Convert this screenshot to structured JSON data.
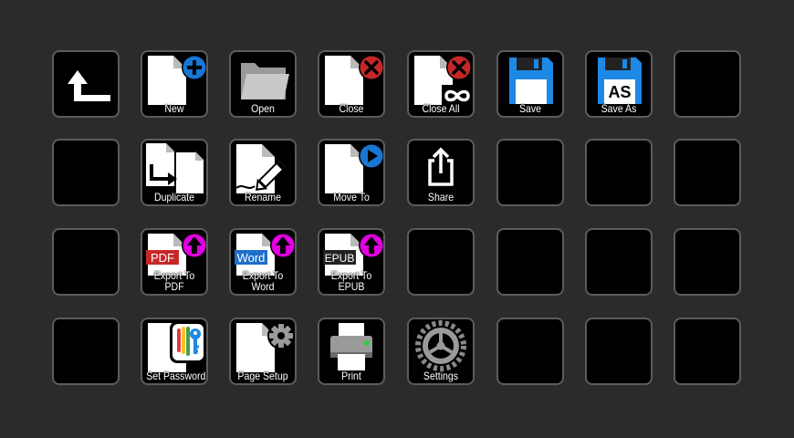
{
  "keys": {
    "new": {
      "label": "New"
    },
    "open": {
      "label": "Open"
    },
    "close": {
      "label": "Close"
    },
    "close_all": {
      "label": "Close All"
    },
    "save": {
      "label": "Save"
    },
    "save_as": {
      "label": "Save As",
      "badge": "AS"
    },
    "duplicate": {
      "label": "Duplicate"
    },
    "rename": {
      "label": "Rename"
    },
    "move_to": {
      "label": "Move To"
    },
    "share": {
      "label": "Share"
    },
    "export_pdf": {
      "label_line1": "Export To",
      "label_line2": "PDF",
      "badge": "PDF"
    },
    "export_word": {
      "label_line1": "Export To",
      "label_line2": "Word",
      "badge": "Word"
    },
    "export_epub": {
      "label_line1": "Export To",
      "label_line2": "EPUB",
      "badge": "EPUB"
    },
    "set_password": {
      "label": "Set Password"
    },
    "page_setup": {
      "label": "Page Setup"
    },
    "print": {
      "label": "Print"
    },
    "settings": {
      "label": "Settings"
    }
  },
  "icons": {
    "back": "back-arrow-icon",
    "new": "document-plus-icon",
    "open": "folder-icon",
    "close": "document-x-icon",
    "close_all": "document-x-infinity-icon",
    "save": "floppy-disk-icon",
    "save_as": "floppy-disk-as-icon",
    "duplicate": "duplicate-documents-icon",
    "rename": "document-pencil-icon",
    "move_to": "document-play-icon",
    "share": "share-icon",
    "export_pdf": "document-pdf-upload-icon",
    "export_word": "document-word-upload-icon",
    "export_epub": "document-epub-upload-icon",
    "set_password": "document-key-icon",
    "page_setup": "document-gear-icon",
    "print": "printer-icon",
    "settings": "gear-icon"
  },
  "colors": {
    "background": "#2b2b2b",
    "key_fill": "#000000",
    "key_border": "#5c5c5c",
    "add_blue": "#1976d2",
    "close_red": "#c62828",
    "floppy_blue": "#1e88e5",
    "upload_magenta": "#e000e0",
    "pdf_red": "#c62828",
    "word_blue": "#1e6fc8",
    "epub_black": "#222222",
    "led_green": "#2ecc40"
  }
}
